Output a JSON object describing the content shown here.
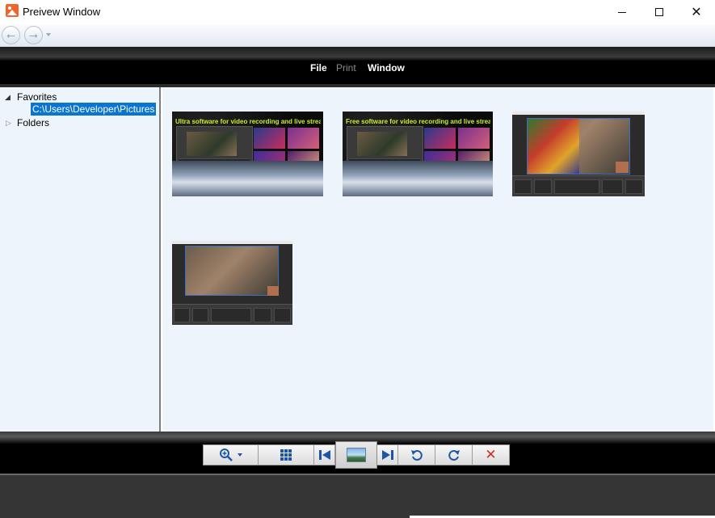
{
  "window": {
    "title": "Preivew Window",
    "icon": "picture-icon",
    "controls": [
      "minimize-icon",
      "maximize-icon",
      "close-icon"
    ]
  },
  "nav": {
    "back_icon": "back-arrow-icon",
    "forward_icon": "forward-arrow-icon",
    "history_icon": "dropdown-icon"
  },
  "menu": {
    "file": "File",
    "print": "Print",
    "window": "Window"
  },
  "tree": {
    "favorites": "Favorites",
    "selected_path": "C:\\Users\\Developer\\Pictures",
    "folders": "Folders"
  },
  "thumbnails": [
    {
      "caption": "Ultra software for video recording and live streaming"
    },
    {
      "caption": "Free software for video recording and live streaming"
    },
    {
      "caption": ""
    },
    {
      "caption": ""
    }
  ],
  "toolbar": {
    "zoom_icon": "zoom-icon",
    "grid_icon": "grid-view-icon",
    "prev_icon": "skip-previous-icon",
    "single_icon": "single-image-view-icon",
    "next_icon": "skip-next-icon",
    "rotate_left_icon": "rotate-left-icon",
    "rotate_right_icon": "rotate-right-icon",
    "delete_icon": "delete-icon"
  },
  "colors": {
    "selection": "#0a75d0",
    "pane_bg": "#eef4fb",
    "band": "#000000",
    "toolbar_icon": "#1d56a8",
    "delete": "#d22a2a",
    "app_icon": "#f0652a"
  }
}
